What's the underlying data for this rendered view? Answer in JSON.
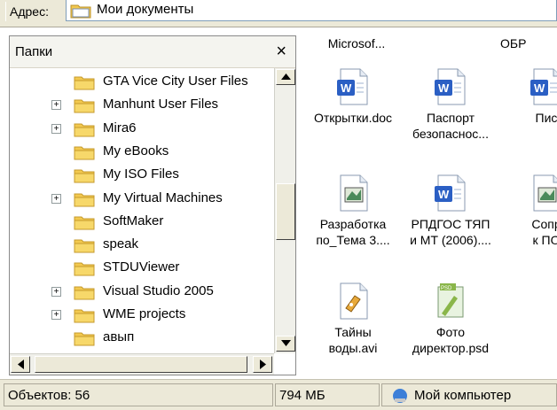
{
  "address": {
    "label": "Адрес:",
    "value": "Мои документы"
  },
  "folders_pane": {
    "title": "Папки",
    "close": "×",
    "items": [
      {
        "label": "GTA Vice City User Files",
        "expandable": false
      },
      {
        "label": "Manhunt User Files",
        "expandable": true
      },
      {
        "label": "Mira6",
        "expandable": true
      },
      {
        "label": "My eBooks",
        "expandable": false
      },
      {
        "label": "My ISO Files",
        "expandable": false
      },
      {
        "label": "My Virtual Machines",
        "expandable": true
      },
      {
        "label": "SoftMaker",
        "expandable": false
      },
      {
        "label": "speak",
        "expandable": false
      },
      {
        "label": "STDUViewer",
        "expandable": false
      },
      {
        "label": "Visual Studio 2005",
        "expandable": true
      },
      {
        "label": "WME projects",
        "expandable": true
      },
      {
        "label": "авып",
        "expandable": false
      }
    ],
    "expander_glyph": "+"
  },
  "files": {
    "top_row": [
      "Microsof...",
      "ОБР"
    ],
    "items": [
      {
        "name": "Открытки.doc",
        "icon": "word-doc-icon"
      },
      {
        "name": "Паспорт\nбезопаснос...",
        "icon": "word-doc-icon"
      },
      {
        "name": "Пис",
        "icon": "word-doc-icon"
      },
      {
        "name": "Разработка\nпо_Тема 3....",
        "icon": "document-icon"
      },
      {
        "name": "РПДГОС ТЯП\nи МТ (2006)....",
        "icon": "word-doc-icon"
      },
      {
        "name": "Сопр\nк ПО",
        "icon": "document-icon"
      },
      {
        "name": "Тайны\nводы.avi",
        "icon": "video-file-icon"
      },
      {
        "name": "Фото\nдиректор.psd",
        "icon": "psd-file-icon"
      }
    ]
  },
  "status": {
    "objects": "Объектов: 56",
    "size": "794 МБ",
    "location": "Мой компьютер"
  },
  "colors": {
    "folder": "#f3c94f",
    "word_blue": "#2b5fc4",
    "chrome": "#ece9d8"
  }
}
